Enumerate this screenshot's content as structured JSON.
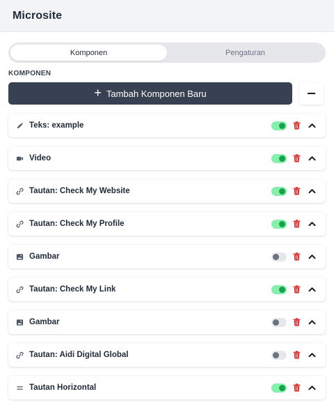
{
  "header": {
    "title": "Microsite"
  },
  "tabs": [
    {
      "label": "Komponen",
      "active": true
    },
    {
      "label": "Pengaturan",
      "active": false
    }
  ],
  "section_label": "KOMPONEN",
  "add_button": {
    "label": "Tambah Komponen Baru",
    "icon": "plus-icon"
  },
  "collapse_button": {
    "icon": "minus-icon"
  },
  "colors": {
    "toggle_on_track": "#86efac",
    "toggle_on_knob": "#16a34a",
    "toggle_off_knob": "#6b7280",
    "trash": "#dc2626",
    "button_dark": "#374151"
  },
  "components": [
    {
      "label": "Teks: example",
      "icon": "pencil-icon",
      "enabled": true
    },
    {
      "label": "Video",
      "icon": "video-icon",
      "enabled": true
    },
    {
      "label": "Tautan: Check My Website",
      "icon": "link-icon",
      "enabled": true
    },
    {
      "label": "Tautan: Check My Profile",
      "icon": "link-icon",
      "enabled": true
    },
    {
      "label": "Gambar",
      "icon": "image-icon",
      "enabled": false
    },
    {
      "label": "Tautan: Check My Link",
      "icon": "link-icon",
      "enabled": true
    },
    {
      "label": "Gambar",
      "icon": "image-icon",
      "enabled": false
    },
    {
      "label": "Tautan: Aidi Digital Global",
      "icon": "link-icon",
      "enabled": false
    },
    {
      "label": "Tautan Horizontal",
      "icon": "equals-icon",
      "enabled": true
    }
  ]
}
